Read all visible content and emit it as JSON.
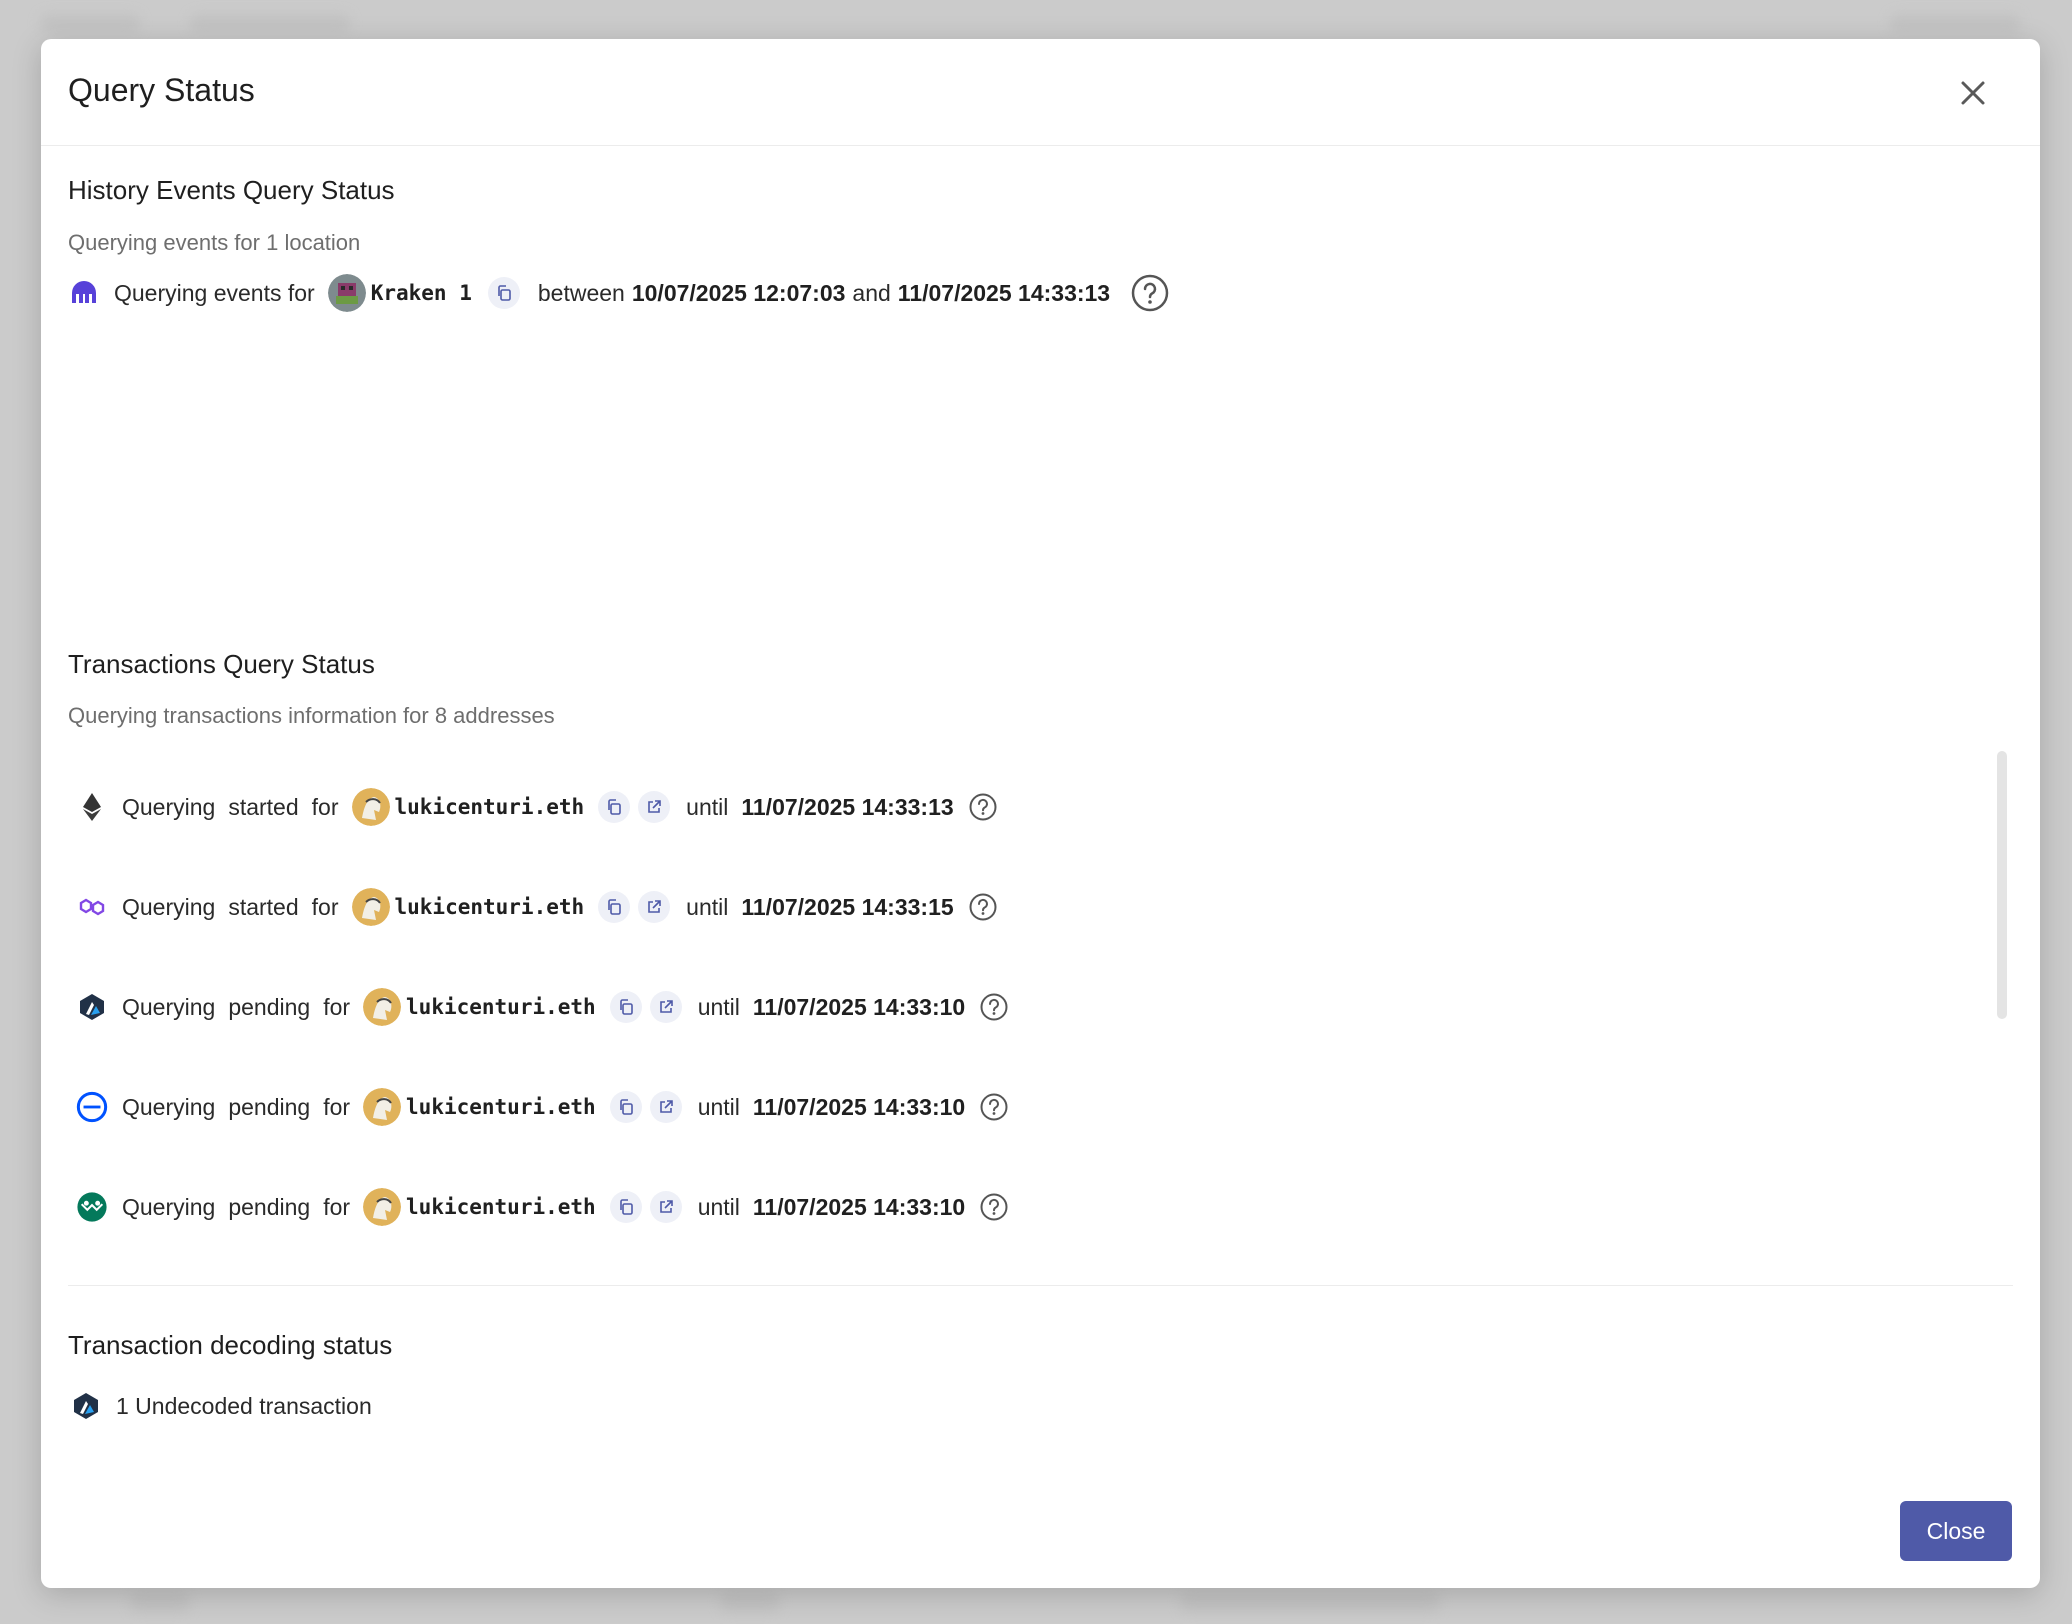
{
  "dialog": {
    "title": "Query Status",
    "close_label": "Close"
  },
  "history": {
    "title": "History Events Query Status",
    "subtitle": "Querying events for 1 location",
    "row": {
      "chain_icon": "kraken-icon",
      "prefix": "Querying events for",
      "account": "Kraken 1",
      "between": "between",
      "from": "10/07/2025 12:07:03",
      "and": "and",
      "to": "11/07/2025 14:33:13"
    }
  },
  "transactions": {
    "title": "Transactions Query Status",
    "subtitle": "Querying transactions information for 8 addresses",
    "rows": [
      {
        "chain_icon": "ethereum-icon",
        "w1": "Querying",
        "w2": "started",
        "w3": "for",
        "address": "lukicenturi.eth",
        "until": "until",
        "time": "11/07/2025 14:33:13"
      },
      {
        "chain_icon": "polygon-icon",
        "w1": "Querying",
        "w2": "started",
        "w3": "for",
        "address": "lukicenturi.eth",
        "until": "until",
        "time": "11/07/2025 14:33:15"
      },
      {
        "chain_icon": "arbitrum-icon",
        "w1": "Querying",
        "w2": "pending",
        "w3": "for",
        "address": "lukicenturi.eth",
        "until": "until",
        "time": "11/07/2025 14:33:10"
      },
      {
        "chain_icon": "base-icon",
        "w1": "Querying",
        "w2": "pending",
        "w3": "for",
        "address": "lukicenturi.eth",
        "until": "until",
        "time": "11/07/2025 14:33:10"
      },
      {
        "chain_icon": "gnosis-icon",
        "w1": "Querying",
        "w2": "pending",
        "w3": "for",
        "address": "lukicenturi.eth",
        "until": "until",
        "time": "11/07/2025 14:33:10"
      }
    ]
  },
  "decoding": {
    "title": "Transaction decoding status",
    "row": {
      "chain_icon": "arbitrum-icon",
      "text": "1 Undecoded transaction"
    }
  },
  "colors": {
    "primary": "#4f5aa8",
    "kraken": "#5741d9",
    "polygon": "#8247e5",
    "base": "#0052ff",
    "gnosis": "#04795b",
    "arbitrum": "#213147"
  }
}
